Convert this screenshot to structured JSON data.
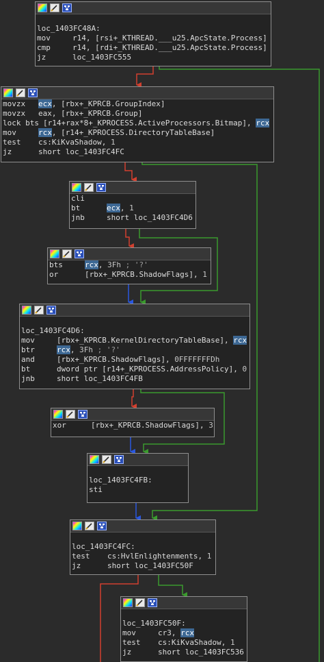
{
  "colors": {
    "background": "#2b2b2b",
    "node_fill": "#232323",
    "node_border": "#8f8f8f",
    "highlight": "#3d6894",
    "edge_true": "#3b9a2e",
    "edge_false": "#d2402f",
    "edge_uncond": "#2a58e0"
  },
  "node_icons": [
    "color-swatch-icon",
    "rename-icon",
    "graph-overview-icon"
  ],
  "nodes": [
    {
      "name": "node-loc-1403fc48a",
      "lines": [
        {
          "blank": true
        },
        {
          "label": "loc_1403FC48A:"
        },
        {
          "mnemonic": "mov",
          "parts": [
            {
              "t": "r14, [rsi+_KTHREAD.___u25.ApcState.Process]"
            }
          ]
        },
        {
          "mnemonic": "cmp",
          "parts": [
            {
              "t": "r14, [rdi+_KTHREAD.___u25.ApcState.Process]"
            }
          ]
        },
        {
          "mnemonic": "jz",
          "parts": [
            {
              "t": "loc_1403FC555"
            }
          ]
        }
      ]
    },
    {
      "name": "node-groupindex",
      "lines": [
        {
          "mnemonic": "movzx",
          "parts": [
            {
              "t": "ecx",
              "c": "hl"
            },
            {
              "t": ", [rbx+_KPRCB.GroupIndex]"
            }
          ]
        },
        {
          "mnemonic": "movzx",
          "parts": [
            {
              "t": "eax, [rbx+_KPRCB.Group]"
            }
          ]
        },
        {
          "mnemonic": "lock bts",
          "parts": [
            {
              "t": "[r14+rax*8+_KPROCESS.ActiveProcessors.Bitmap], "
            },
            {
              "t": "rcx",
              "c": "hl"
            }
          ]
        },
        {
          "mnemonic": "mov",
          "parts": [
            {
              "t": "rcx",
              "c": "hl"
            },
            {
              "t": ", [r14+_KPROCESS.DirectoryTableBase]"
            }
          ]
        },
        {
          "mnemonic": "test",
          "parts": [
            {
              "t": "cs:KiKvaShadow, "
            },
            {
              "t": "1",
              "c": "num"
            }
          ]
        },
        {
          "mnemonic": "jz",
          "parts": [
            {
              "t": "short loc_1403FC4FC"
            }
          ]
        }
      ]
    },
    {
      "name": "node-cli",
      "lines": [
        {
          "mnemonic": "cli",
          "parts": []
        },
        {
          "mnemonic": "bt",
          "parts": [
            {
              "t": "ecx",
              "c": "hl"
            },
            {
              "t": ", "
            },
            {
              "t": "1",
              "c": "num"
            }
          ]
        },
        {
          "mnemonic": "jnb",
          "parts": [
            {
              "t": "short loc_1403FC4D6"
            }
          ]
        }
      ]
    },
    {
      "name": "node-bts",
      "lines": [
        {
          "mnemonic": "bts",
          "parts": [
            {
              "t": "rcx",
              "c": "hl"
            },
            {
              "t": ", "
            },
            {
              "t": "3Fh",
              "c": "num"
            },
            {
              "t": " ; '?'",
              "c": "cmt"
            }
          ]
        },
        {
          "mnemonic": "or",
          "parts": [
            {
              "t": "[rbx+_KPRCB.ShadowFlags], "
            },
            {
              "t": "1",
              "c": "num"
            }
          ]
        }
      ]
    },
    {
      "name": "node-loc-1403fc4d6",
      "lines": [
        {
          "blank": true
        },
        {
          "label": "loc_1403FC4D6:"
        },
        {
          "mnemonic": "mov",
          "parts": [
            {
              "t": "[rbx+_KPRCB.KernelDirectoryTableBase], "
            },
            {
              "t": "rcx",
              "c": "hl"
            }
          ]
        },
        {
          "mnemonic": "btr",
          "parts": [
            {
              "t": "rcx",
              "c": "hl"
            },
            {
              "t": ", "
            },
            {
              "t": "3Fh",
              "c": "num"
            },
            {
              "t": " ; '?'",
              "c": "cmt"
            }
          ]
        },
        {
          "mnemonic": "and",
          "parts": [
            {
              "t": "[rbx+_KPRCB.ShadowFlags], "
            },
            {
              "t": "0FFFFFFFDh",
              "c": "num"
            }
          ]
        },
        {
          "mnemonic": "bt",
          "parts": [
            {
              "t": "dword ptr [r14+_KPROCESS.AddressPolicy], "
            },
            {
              "t": "0",
              "c": "num"
            }
          ]
        },
        {
          "mnemonic": "jnb",
          "parts": [
            {
              "t": "short loc_1403FC4FB"
            }
          ]
        }
      ]
    },
    {
      "name": "node-xor",
      "lines": [
        {
          "mnemonic": "xor",
          "parts": [
            {
              "t": "[rbx+_KPRCB.ShadowFlags], "
            },
            {
              "t": "3",
              "c": "num"
            }
          ]
        }
      ]
    },
    {
      "name": "node-loc-1403fc4fb",
      "lines": [
        {
          "blank": true
        },
        {
          "label": "loc_1403FC4FB:"
        },
        {
          "mnemonic": "sti",
          "parts": []
        }
      ]
    },
    {
      "name": "node-loc-1403fc4fc",
      "lines": [
        {
          "blank": true
        },
        {
          "label": "loc_1403FC4FC:"
        },
        {
          "mnemonic": "test",
          "parts": [
            {
              "t": "cs:HvlEnlightenments, "
            },
            {
              "t": "1",
              "c": "num"
            }
          ]
        },
        {
          "mnemonic": "jz",
          "parts": [
            {
              "t": "short loc_1403FC50F"
            }
          ]
        }
      ]
    },
    {
      "name": "node-loc-1403fc50f",
      "lines": [
        {
          "blank": true
        },
        {
          "label": "loc_1403FC50F:"
        },
        {
          "mnemonic": "mov",
          "parts": [
            {
              "t": "cr3, "
            },
            {
              "t": "rcx",
              "c": "hl"
            }
          ]
        },
        {
          "mnemonic": "test",
          "parts": [
            {
              "t": "cs:KiKvaShadow, "
            },
            {
              "t": "1",
              "c": "num"
            }
          ]
        },
        {
          "mnemonic": "jz",
          "parts": [
            {
              "t": "short loc_1403FC536"
            }
          ]
        }
      ]
    }
  ]
}
